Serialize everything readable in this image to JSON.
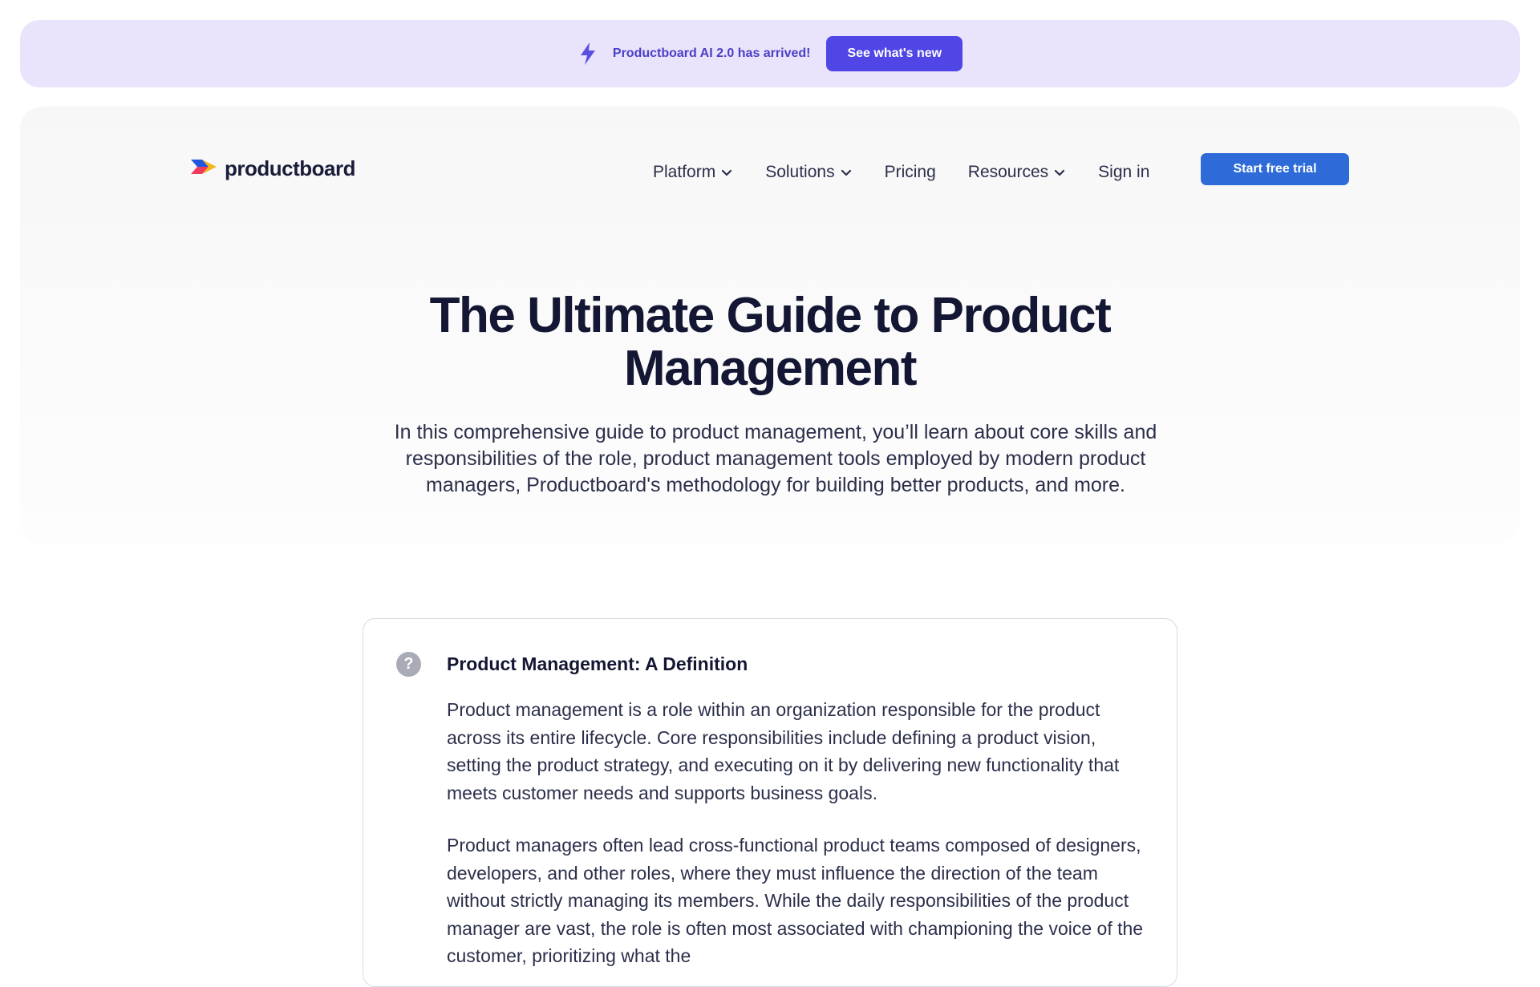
{
  "banner": {
    "icon": "lightning-bolt-icon",
    "text": "Productboard AI 2.0 has arrived!",
    "button_label": "See what's new"
  },
  "nav": {
    "logo_text": "productboard",
    "items": [
      {
        "label": "Platform",
        "dropdown": true
      },
      {
        "label": "Solutions",
        "dropdown": true
      },
      {
        "label": "Pricing",
        "dropdown": false
      },
      {
        "label": "Resources",
        "dropdown": true
      },
      {
        "label": "Sign in",
        "dropdown": false
      }
    ],
    "cta_label": "Start free trial"
  },
  "hero": {
    "title_line1": "The Ultimate Guide to Product",
    "title_line2": "Management",
    "subtitle": "In this comprehensive guide to product management, you’ll learn about core skills and responsibilities of the role, product management tools employed by modern product managers, Productboard's methodology for building better products, and more."
  },
  "definition_card": {
    "icon": "question-icon",
    "title": "Product Management: A Definition",
    "paragraph1": "Product management is a role within an organization responsible for the product across its entire lifecycle. Core responsibilities include defining a product vision, setting the product strategy, and executing on it by delivering new functionality that meets customer needs and supports business goals.",
    "paragraph2": "Product managers often lead cross-functional product teams composed of designers, developers, and other roles, where they must influence the direction of the team without strictly managing its members. While the daily responsibilities of the product manager are vast, the role is often most associated with championing the voice of the customer, prioritizing what the"
  },
  "colors": {
    "banner_bg": "#e9e3fb",
    "banner_button": "#4f46e5",
    "cta_button": "#2e6bd9",
    "heading": "#141733"
  }
}
